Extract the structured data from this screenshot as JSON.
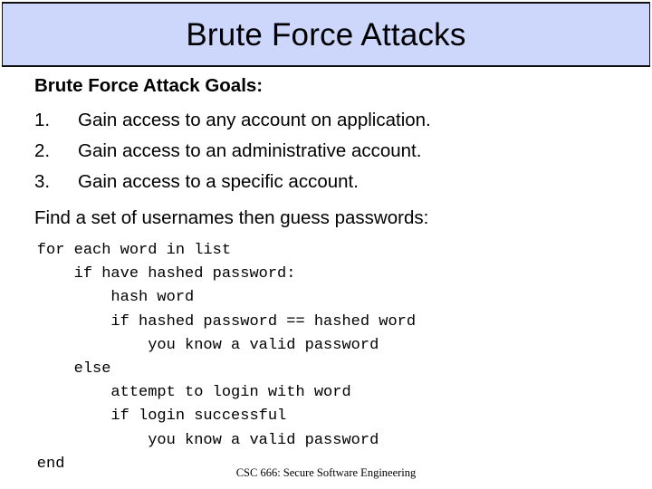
{
  "slide": {
    "title": "Brute Force Attacks",
    "title_band_color": "#ccd7fb",
    "border_color": "#111111",
    "background_color": "#ffffff",
    "text_color": "#000000"
  },
  "body": {
    "goals_heading": "Brute Force Attack Goals:",
    "goals": [
      {
        "number": "1.",
        "text": "Gain access to any account on application."
      },
      {
        "number": "2.",
        "text": "Gain access to an administrative account."
      },
      {
        "number": "3.",
        "text": "Gain access to a specific account."
      }
    ],
    "find_line": "Find a set of usernames then guess passwords:"
  },
  "pseudocode": {
    "lines": [
      "    for each word in list",
      "        if have hashed password:",
      "            hash word",
      "            if hashed password == hashed word",
      "                you know a valid password",
      "        else",
      "            attempt to login with word",
      "            if login successful",
      "                you know a valid password",
      "    end"
    ]
  },
  "footer": {
    "text": "CSC 666: Secure Software Engineering"
  }
}
